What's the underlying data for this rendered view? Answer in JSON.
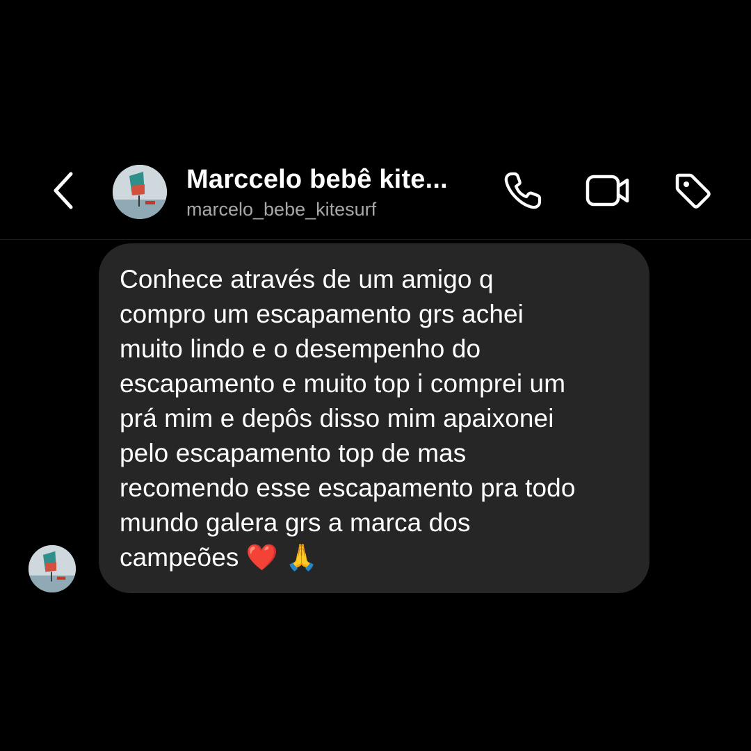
{
  "header": {
    "display_name": "Marccelo bebê kite...",
    "username": "marcelo_bebe_kitesurf",
    "icons": {
      "back": "chevron-left-icon",
      "call": "phone-icon",
      "video": "video-camera-icon",
      "tag": "tag-icon"
    }
  },
  "message": {
    "text": "Conhece através de um amigo q\ncompro um escapamento grs achei\nmuito lindo e o desempenho do\nescapamento e muito top i comprei um\nprá mim e depôs disso mim apaixonei\npelo escapamento top de mas\nrecomendo esse escapamento pra todo\nmundo galera grs a marca dos\ncampeões ❤️ 🙏"
  },
  "colors": {
    "background": "#000000",
    "bubble": "#262626",
    "text_primary": "#ffffff",
    "text_secondary": "#a8a8a8"
  }
}
